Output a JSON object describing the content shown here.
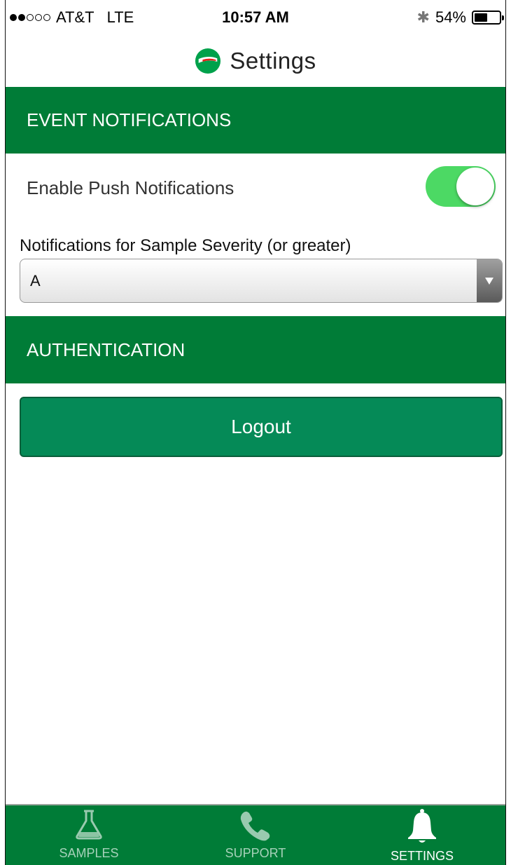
{
  "status_bar": {
    "carrier": "AT&T",
    "network": "LTE",
    "time": "10:57 AM",
    "battery_percent": "54%",
    "battery_level": 0.54,
    "signal_bars_filled": 2,
    "signal_bars_total": 5
  },
  "header": {
    "title": "Settings",
    "logo_icon": "castrol-logo-icon"
  },
  "sections": {
    "event_notifications": "EVENT NOTIFICATIONS",
    "authentication": "AUTHENTICATION"
  },
  "push": {
    "label": "Enable Push Notifications",
    "enabled": true
  },
  "severity": {
    "label": "Notifications for Sample Severity (or greater)",
    "selected": "A"
  },
  "logout_label": "Logout",
  "tabs": [
    {
      "label": "SAMPLES",
      "icon": "flask-icon",
      "active": false
    },
    {
      "label": "SUPPORT",
      "icon": "phone-icon",
      "active": false
    },
    {
      "label": "SETTINGS",
      "icon": "bell-icon",
      "active": true
    }
  ],
  "colors": {
    "primary_green": "#007c37",
    "button_green": "#058a57",
    "toggle_on": "#4cd964"
  }
}
